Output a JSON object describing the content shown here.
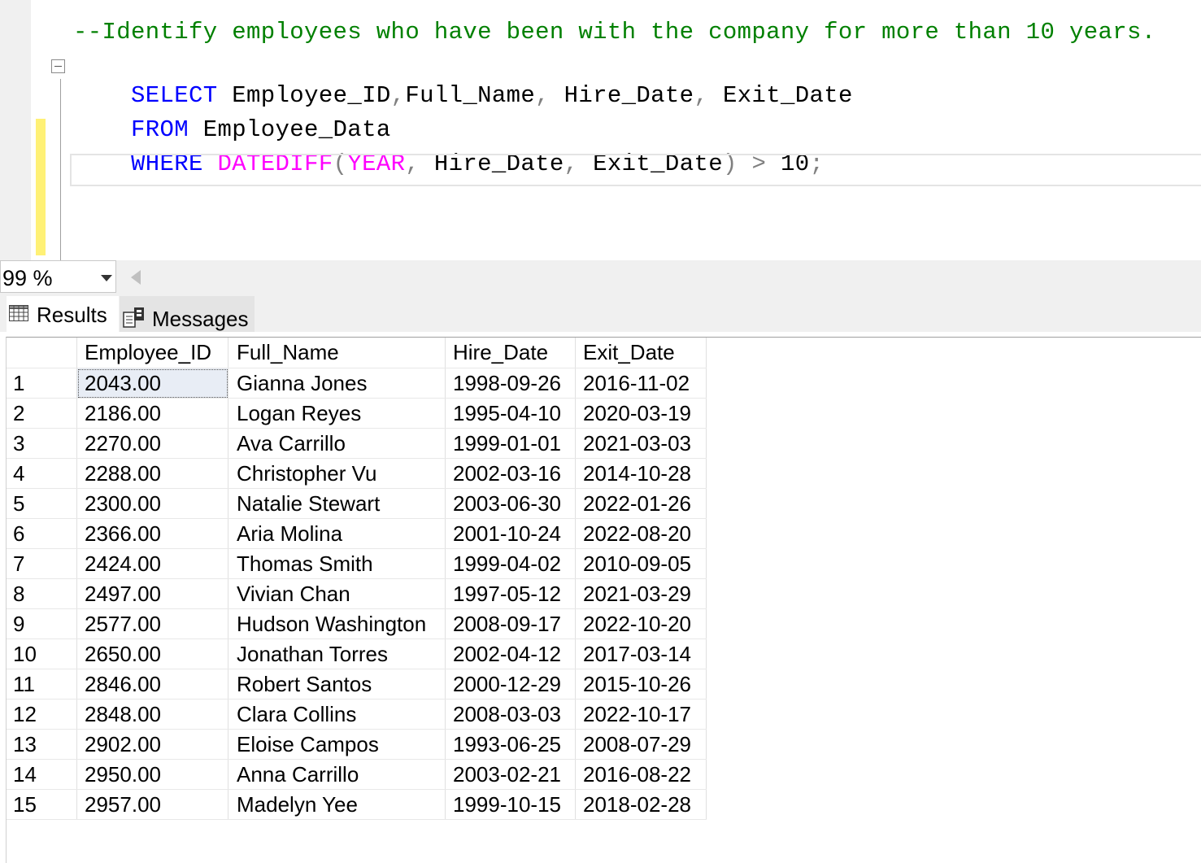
{
  "editor": {
    "comment": "--Identify employees who have been with the company for more than 10 years.",
    "line2": {
      "kw": "SELECT",
      "cols": [
        " Employee_ID",
        ",",
        "Full_Name",
        ", ",
        "Hire_Date",
        ", ",
        "Exit_Date"
      ]
    },
    "line3": {
      "kw": "FROM",
      "table": " Employee_Data"
    },
    "line4": {
      "kw": "WHERE",
      "sp": " ",
      "fn": "DATEDIFF",
      "open": "(",
      "arg1": "YEAR",
      "c1": ", ",
      "arg2": "Hire_Date",
      "c2": ", ",
      "arg3": "Exit_Date",
      "close": ")",
      "gt": " > ",
      "num": "10",
      "semi": ";"
    }
  },
  "zoom": {
    "value": "99 %"
  },
  "tabs": {
    "results": "Results",
    "messages": "Messages"
  },
  "grid": {
    "headers": [
      "",
      "Employee_ID",
      "Full_Name",
      "Hire_Date",
      "Exit_Date"
    ],
    "rows": [
      [
        "1",
        "2043.00",
        "Gianna Jones",
        "1998-09-26",
        "2016-11-02"
      ],
      [
        "2",
        "2186.00",
        "Logan Reyes",
        "1995-04-10",
        "2020-03-19"
      ],
      [
        "3",
        "2270.00",
        "Ava Carrillo",
        "1999-01-01",
        "2021-03-03"
      ],
      [
        "4",
        "2288.00",
        "Christopher Vu",
        "2002-03-16",
        "2014-10-28"
      ],
      [
        "5",
        "2300.00",
        "Natalie Stewart",
        "2003-06-30",
        "2022-01-26"
      ],
      [
        "6",
        "2366.00",
        "Aria Molina",
        "2001-10-24",
        "2022-08-20"
      ],
      [
        "7",
        "2424.00",
        "Thomas Smith",
        "1999-04-02",
        "2010-09-05"
      ],
      [
        "8",
        "2497.00",
        "Vivian Chan",
        "1997-05-12",
        "2021-03-29"
      ],
      [
        "9",
        "2577.00",
        "Hudson Washington",
        "2008-09-17",
        "2022-10-20"
      ],
      [
        "10",
        "2650.00",
        "Jonathan Torres",
        "2002-04-12",
        "2017-03-14"
      ],
      [
        "11",
        "2846.00",
        "Robert Santos",
        "2000-12-29",
        "2015-10-26"
      ],
      [
        "12",
        "2848.00",
        "Clara Collins",
        "2008-03-03",
        "2022-10-17"
      ],
      [
        "13",
        "2902.00",
        "Eloise Campos",
        "1993-06-25",
        "2008-07-29"
      ],
      [
        "14",
        "2950.00",
        "Anna Carrillo",
        "2003-02-21",
        "2016-08-22"
      ],
      [
        "15",
        "2957.00",
        "Madelyn Yee",
        "1999-10-15",
        "2018-02-28"
      ]
    ]
  }
}
